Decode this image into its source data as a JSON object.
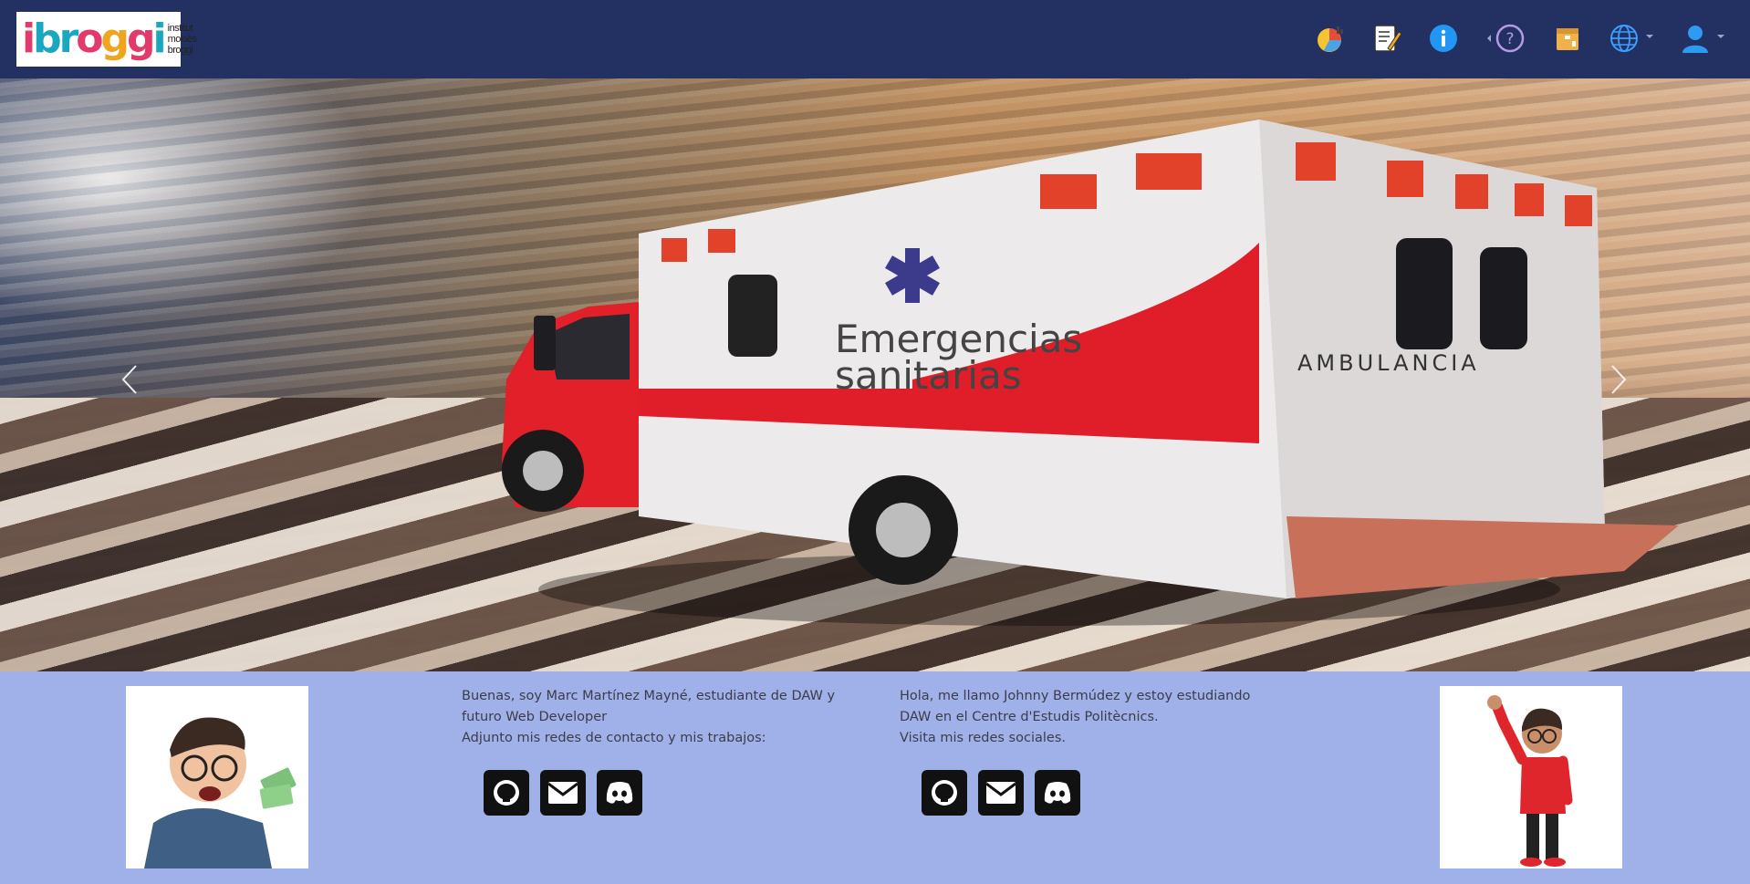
{
  "brand": {
    "logo_mark_1": "i",
    "logo_mark_2": "broggi",
    "logo_text_line1": "institut",
    "logo_text_line2": "moisès broggi"
  },
  "navbar": {
    "icons": [
      {
        "name": "statistics-pie-icon"
      },
      {
        "name": "notes-icon"
      },
      {
        "name": "info-icon"
      },
      {
        "name": "help-icon"
      },
      {
        "name": "archive-box-icon"
      },
      {
        "name": "language-globe-icon"
      },
      {
        "name": "user-profile-icon"
      }
    ],
    "colors": {
      "background": "#223161"
    }
  },
  "hero": {
    "image": "ambulance-photo",
    "vehicle_text_1": "Emergencias",
    "vehicle_text_2": "sanitarias",
    "vehicle_text_3": "AMBULANCIA"
  },
  "profiles": [
    {
      "bio_line1": "Buenas, soy Marc Martínez Mayné, estudiante de DAW y futuro Web Developer",
      "bio_line2": "Adjunto mis redes de contacto y mis trabajos:",
      "links": [
        "github-icon",
        "mail-icon",
        "discord-icon"
      ]
    },
    {
      "bio_line1": "Hola, me llamo Johnny Bermúdez y estoy estudiando DAW en el Centre d'Estudis Politècnics.",
      "bio_line2": "Visita mis redes sociales.",
      "links": [
        "github-icon",
        "mail-icon",
        "discord-icon"
      ]
    }
  ],
  "colors": {
    "footer_background": "#9fb1e8",
    "social_button": "#111111"
  }
}
